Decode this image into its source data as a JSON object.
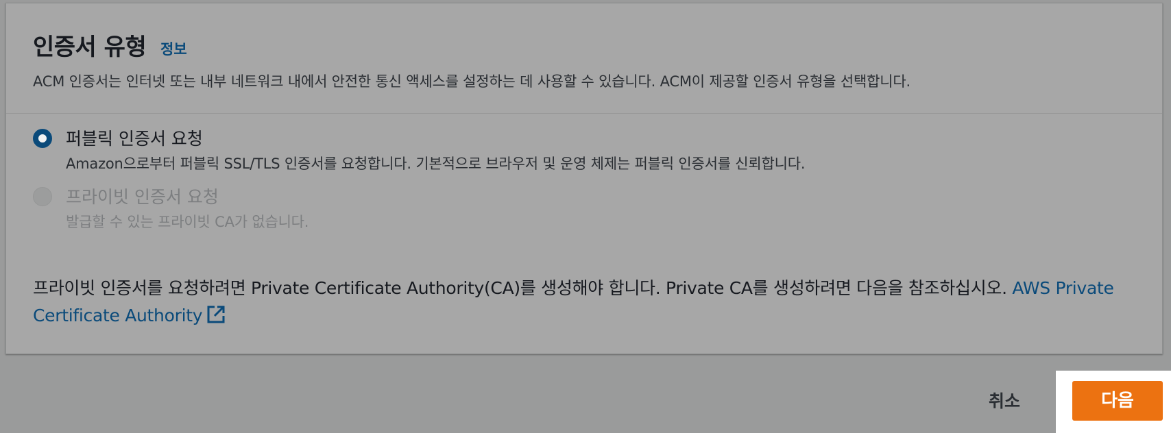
{
  "section": {
    "title": "인증서 유형",
    "info_link": "정보",
    "description": "ACM 인증서는 인터넷 또는 내부 네트워크 내에서 안전한 통신 액세스를 설정하는 데 사용할 수 있습니다. ACM이 제공할 인증서 유형을 선택합니다."
  },
  "options": [
    {
      "label": "퍼블릭 인증서 요청",
      "description": "Amazon으로부터 퍼블릭 SSL/TLS 인증서를 요청합니다. 기본적으로 브라우저 및 운영 체제는 퍼블릭 인증서를 신뢰합니다.",
      "selected": true,
      "disabled": false
    },
    {
      "label": "프라이빗 인증서 요청",
      "description": "발급할 수 있는 프라이빗 CA가 없습니다.",
      "selected": false,
      "disabled": true
    }
  ],
  "note": {
    "text": "프라이빗 인증서를 요청하려면 Private Certificate Authority(CA)를 생성해야 합니다. Private CA를 생성하려면 다음을 참조하십시오. ",
    "link_text": "AWS Private Certificate Authority",
    "link_icon": "external-link-icon"
  },
  "actions": {
    "cancel_label": "취소",
    "next_label": "다음"
  },
  "colors": {
    "accent": "#0a4a7a",
    "primary_button": "#ec7211",
    "overlay_background": "#9a9b9b"
  }
}
